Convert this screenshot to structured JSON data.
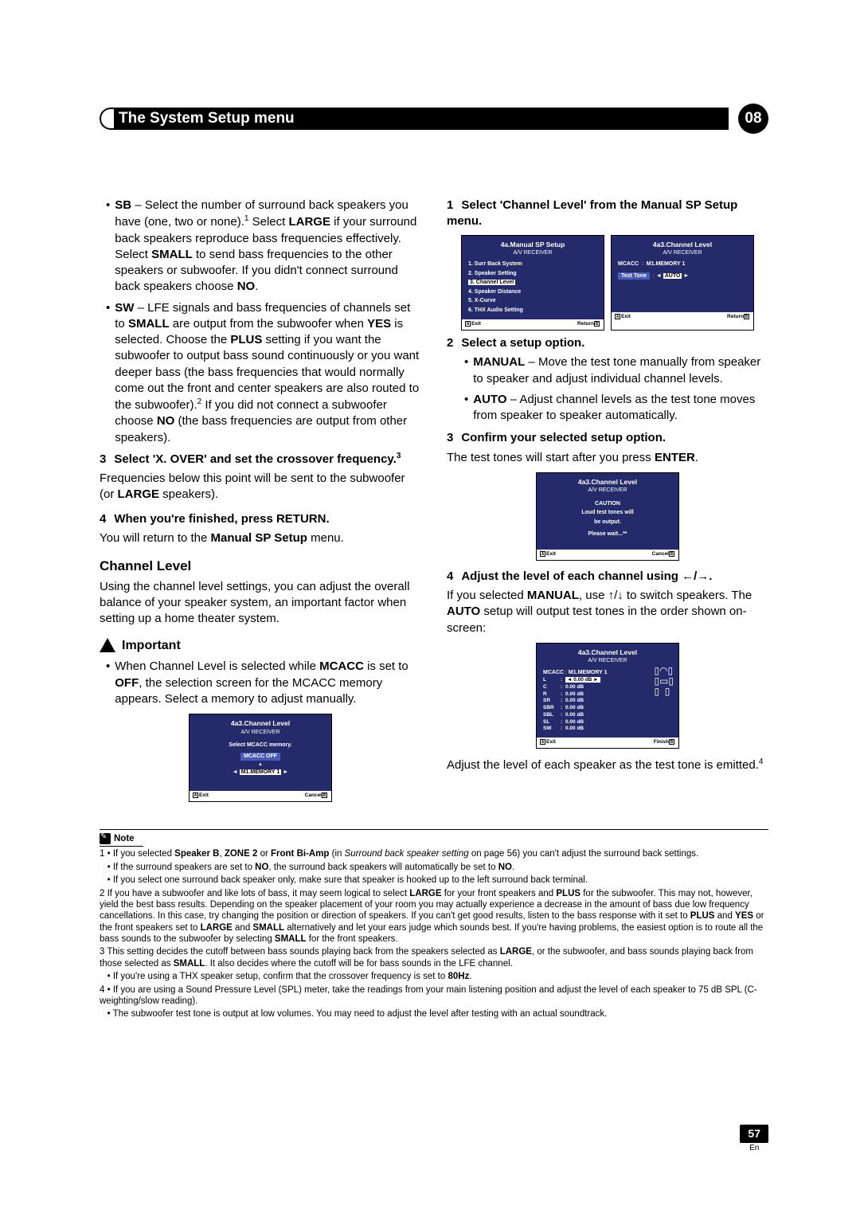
{
  "header": {
    "title": "The System Setup menu",
    "chapter": "08"
  },
  "left": {
    "sb": {
      "label": "SB",
      "text1": " – Select the number of surround back speakers you have (one, two or none).",
      "fn1": "1",
      "text2": " Select ",
      "b1": "LARGE",
      "text3": " if your surround back speakers reproduce bass frequencies effectively. Select ",
      "b2": "SMALL",
      "text4": " to send bass frequencies to the other speakers or subwoofer. If you didn't connect surround back speakers choose ",
      "b3": "NO",
      "text5": "."
    },
    "sw": {
      "label": "SW",
      "t1": " – LFE signals and bass frequencies of channels set to ",
      "b1": "SMALL",
      "t2": " are output from the subwoofer when ",
      "b2": "YES",
      "t3": " is selected. Choose the ",
      "b3": "PLUS",
      "t4": " setting if you want the subwoofer to output bass sound continuously or you want deeper bass (the bass frequencies that would normally come out the front and center speakers are also routed to the subwoofer).",
      "fn": "2",
      "t5": " If you did not connect a subwoofer choose ",
      "b4": "NO",
      "t6": " (the bass frequencies are output from other speakers)."
    },
    "s3": {
      "num": "3",
      "title": "Select 'X. OVER' and set the crossover frequency.",
      "fn": "3",
      "body1": "Frequencies below this point will be sent to the subwoofer (or ",
      "b": "LARGE",
      "body2": " speakers)."
    },
    "s4": {
      "num": "4",
      "title": "When you're finished, press RETURN.",
      "body1": "You will return to the ",
      "b": "Manual SP Setup",
      "body2": " menu."
    },
    "chlevel_h": "Channel Level",
    "chlevel_body": "Using the channel level settings, you can adjust the overall balance of your speaker system, an important factor when setting up a home theater system.",
    "important": "Important",
    "imp_body": {
      "t1": "When Channel Level is selected while ",
      "b1": "MCACC",
      "t2": " is set to ",
      "b2": "OFF",
      "t3": ", the selection screen for the MCACC memory appears. Select a memory to adjust manually."
    },
    "osd1": {
      "title": "4a3.Channel Level",
      "sub": "A/V RECEIVER",
      "line1": "Select MCACC memory.",
      "off": "MCACC OFF",
      "mem": "M1.MEMORY 1",
      "exit": "Exit",
      "cancel": "Cancel"
    }
  },
  "right": {
    "s1": {
      "num": "1",
      "title": "Select 'Channel Level' from the Manual SP Setup menu."
    },
    "osdA": {
      "title": "4a.Manual SP Setup",
      "sub": "A/V RECEIVER",
      "items": [
        "1. Surr Back System",
        "2. Speaker Setting",
        "3. Channel Level",
        "4. Speaker Distance",
        "5. X-Curve",
        "6. THX Audio Setting"
      ],
      "exit": "Exit",
      "return": "Return"
    },
    "osdB": {
      "title": "4a3.Channel Level",
      "sub": "A/V RECEIVER",
      "mcacc_l": "MCACC",
      "mcacc_v": "M1.MEMORY 1",
      "tt_l": "Test Tone",
      "tt_v": "AUTO",
      "exit": "Exit",
      "return": "Return"
    },
    "s2": {
      "num": "2",
      "title": "Select a setup option.",
      "manual_l": "MANUAL",
      "manual_t": " – Move the test tone manually from speaker to speaker and adjust individual channel levels.",
      "auto_l": "AUTO",
      "auto_t": " – Adjust channel levels as the test tone moves from speaker to speaker automatically."
    },
    "s3": {
      "num": "3",
      "title": "Confirm your selected setup option.",
      "t1": "The test tones will start after you press ",
      "b": "ENTER",
      "t2": "."
    },
    "osdC": {
      "title": "4a3.Channel Level",
      "sub": "A/V RECEIVER",
      "caution": "CAUTION",
      "l1": "Loud test tones will",
      "l2": "be output.",
      "l3": "Please wait...**",
      "exit": "Exit",
      "cancel": "Cancel"
    },
    "s4": {
      "num": "4",
      "title": "Adjust the level of each channel using ",
      "arrows": "←/→.",
      "t1": "If you selected ",
      "b1": "MANUAL",
      "t2": ", use ",
      "ud": "↑/↓",
      "t3": " to switch speakers. The ",
      "b2": "AUTO",
      "t4": " setup will output test tones in the order shown on-screen:"
    },
    "osdD": {
      "title": "4a3.Channel Level",
      "sub": "A/V RECEIVER",
      "mcacc_l": "MCACC",
      "mcacc_v": "M1.MEMORY 1",
      "rows": [
        [
          "L",
          "0.00 dB"
        ],
        [
          "C",
          "0.00 dB"
        ],
        [
          "R",
          "0.00 dB"
        ],
        [
          "SR",
          "0.00 dB"
        ],
        [
          "SBR",
          "0.00 dB"
        ],
        [
          "SBL",
          "0.00 dB"
        ],
        [
          "SL",
          "0.00 dB"
        ],
        [
          "SW",
          "0.00 dB"
        ]
      ],
      "exit": "Exit",
      "finish": "Finish"
    },
    "tail": {
      "t1": "Adjust the level of each speaker as the test tone is emitted.",
      "fn": "4"
    }
  },
  "notes": {
    "head": "Note",
    "n1": {
      "t1": "If you selected ",
      "b1": "Speaker B",
      "t2": ", ",
      "b2": "ZONE 2",
      "t3": " or ",
      "b3": "Front Bi-Amp",
      "t4": " (in ",
      "i": "Surround back speaker setting",
      "t5": " on page 56) you can't adjust the surround back settings."
    },
    "n1b": {
      "t1": "If the surround speakers are set to ",
      "b": "NO",
      "t2": ", the surround back speakers will automatically be set to ",
      "b2": "NO",
      "t3": "."
    },
    "n1c": "If you select one surround back speaker only, make sure that speaker is hooked up to the left surround back terminal.",
    "n2": {
      "t1": "If you have a subwoofer and like lots of bass, it may seem logical to select ",
      "b1": "LARGE",
      "t2": " for your front speakers and ",
      "b2": "PLUS",
      "t3": " for the subwoofer. This may not, however, yield the best bass results. Depending on the speaker placement of your room you may actually experience a decrease in the amount of bass due low frequency cancellations. In this case, try changing the position or direction of speakers. If you can't get good results, listen to the bass response with it set to ",
      "b3": "PLUS",
      "t4": " and ",
      "b4": "YES",
      "t5": " or the front speakers set to ",
      "b5": "LARGE",
      "t6": " and ",
      "b6": "SMALL",
      "t7": " alternatively and let your ears judge which sounds best. If you're having problems, the easiest option is to route all the bass sounds to the subwoofer by selecting ",
      "b7": "SMALL",
      "t8": " for the front speakers."
    },
    "n3": {
      "t1": "This setting decides the cutoff between bass sounds playing back from the speakers selected as ",
      "b1": "LARGE",
      "t2": ", or the subwoofer, and bass sounds playing back from those selected as ",
      "b2": "SMALL",
      "t3": ". It also decides where the cutoff will be for bass sounds in the LFE channel."
    },
    "n3b": {
      "t1": "If you're using a THX speaker setup, confirm that the crossover frequency is set to ",
      "b": "80Hz",
      "t2": "."
    },
    "n4": "If you are using a Sound Pressure Level (SPL) meter, take the readings from your main listening position and adjust the level of each speaker to 75 dB SPL (C-weighting/slow reading).",
    "n4b": "The subwoofer test tone is output at low volumes. You may need to adjust the level after testing with an actual soundtrack."
  },
  "page": {
    "num": "57",
    "lang": "En"
  }
}
